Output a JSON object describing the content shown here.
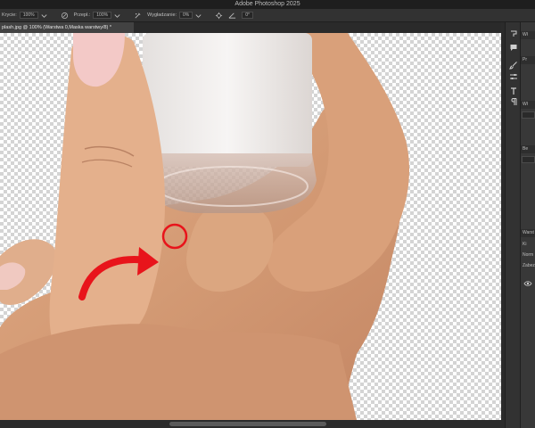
{
  "app": {
    "window_title": "Adobe Photoshop 2025"
  },
  "options_bar": {
    "opacity_label": "Krycie:",
    "opacity_value": "100%",
    "flow_label": "Przepł.:",
    "flow_value": "100%",
    "smoothing_label": "Wygładzanie:",
    "smoothing_value": "0%",
    "angle_value": "0°",
    "icons": [
      "airbrush-icon",
      "pressure-opacity-icon",
      "smoothing-gear-icon",
      "angle-icon"
    ]
  },
  "document": {
    "tab_title": "plash.jpg @ 100% (Warstwa 0,Maska warstwy/8) *",
    "tab_close": "×"
  },
  "annotation": {
    "arrow_color": "#e8141b",
    "circle_color": "#e8141b"
  },
  "tools": [
    "history-brush-icon",
    "comments-icon",
    "brush-icon",
    "adjust-sliders-icon",
    "type-icon",
    "paragraph-icon"
  ],
  "right_panel": {
    "sections": [
      "Wł",
      "Pr",
      "Wł",
      "Be",
      "Warst"
    ],
    "lines": [
      "Ki",
      "Norm",
      "Zabez"
    ]
  },
  "colors": {
    "ui_dark": "#262626",
    "panel": "#323232",
    "accent_red": "#e8141b"
  }
}
